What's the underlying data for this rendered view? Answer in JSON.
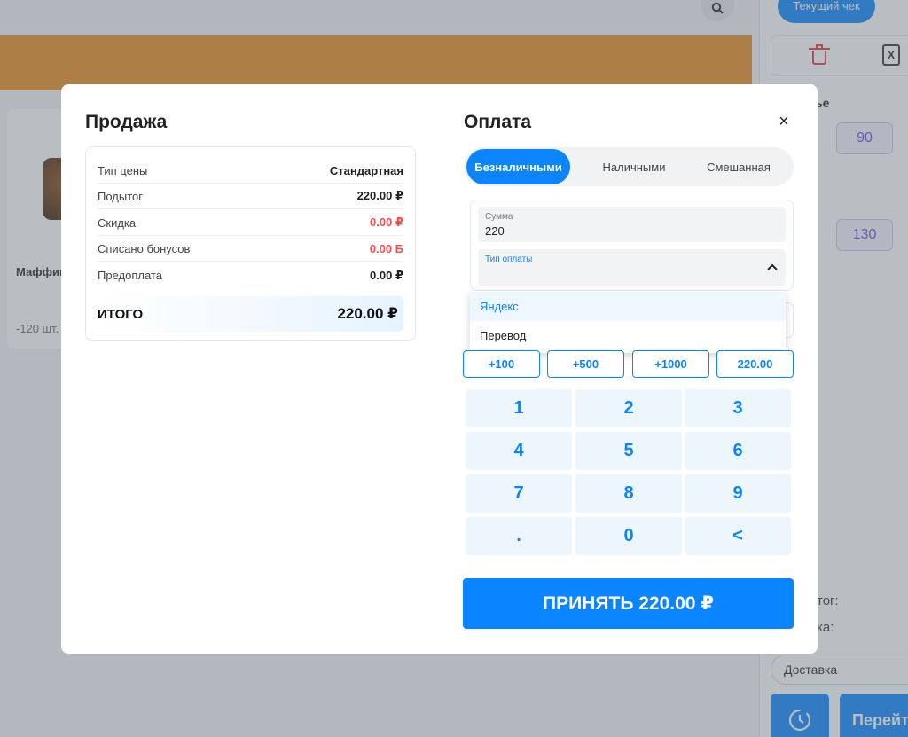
{
  "background": {
    "current_check_tab": "Текущий чек",
    "product_name": "Маффин",
    "product_qty": "-120 шт.",
    "side_heading_partial": "ье",
    "side_qty_1": "90",
    "side_qty_2": "130",
    "side_subtotal_partial": "тог:",
    "side_discount_partial": "ка:",
    "delivery_select": "Доставка",
    "go_button_partial": "Перейт",
    "xlsx_icon_glyph": "X"
  },
  "sale": {
    "title": "Продажа",
    "rows": [
      {
        "label": "Тип цены",
        "value": "Стандартная",
        "color": "#222222"
      },
      {
        "label": "Подытог",
        "value": "220.00 ₽",
        "color": "#222222"
      },
      {
        "label": "Скидка",
        "value": "0.00 ₽",
        "color": "#ff4d4d"
      },
      {
        "label": "Списано бонусов",
        "value": "0.00 Б",
        "color": "#ff4d4d"
      },
      {
        "label": "Предоплата",
        "value": "0.00 ₽",
        "color": "#222222"
      }
    ],
    "total_label": "ИТОГО",
    "total_value": "220.00 ₽"
  },
  "payment": {
    "title": "Оплата",
    "close_glyph": "×",
    "tabs": [
      {
        "label": "Безналичными",
        "active": true
      },
      {
        "label": "Наличными",
        "active": false
      },
      {
        "label": "Смешанная",
        "active": false
      }
    ],
    "amount_label": "Сумма",
    "amount_value": "220",
    "type_label": "Тип оплаты",
    "type_value": "",
    "dropdown_options": [
      {
        "label": "Яндекс",
        "highlighted": true
      },
      {
        "label": "Перевод",
        "highlighted": false
      }
    ],
    "quick_amounts": [
      "+100",
      "+500",
      "+1000",
      "220.00"
    ],
    "keypad": [
      "1",
      "2",
      "3",
      "4",
      "5",
      "6",
      "7",
      "8",
      "9",
      ".",
      "0",
      "<"
    ],
    "accept_label": "ПРИНЯТЬ 220.00 ₽"
  },
  "colors": {
    "accent": "#0a84ff",
    "negative": "#ff4d4d",
    "banner": "#ea8b1e"
  }
}
